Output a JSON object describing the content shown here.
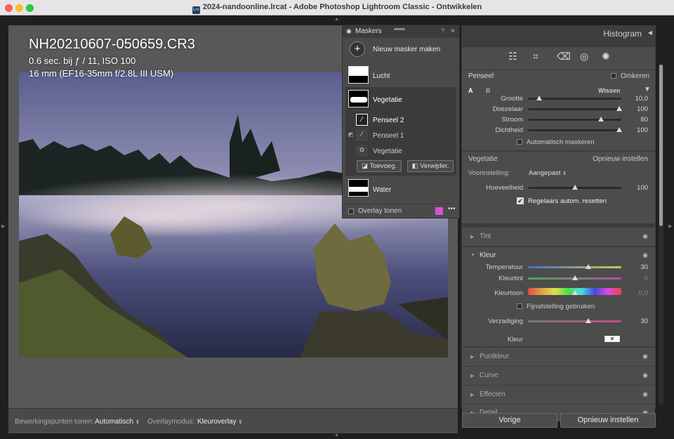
{
  "window": {
    "title": "2024-nandoonline.lrcat - Adobe Photoshop Lightroom Classic - Ontwikkelen",
    "icon_text": "Lrc"
  },
  "photo": {
    "filename": "NH20210607-050659.CR3",
    "exposure": "0.6 sec. bij ƒ / 11, ISO 100",
    "lens": "16 mm (EF16-35mm f/2.8L III USM)"
  },
  "toolbar": {
    "points_label": "Bewerkingspunten tonen:",
    "points_value": "Automatisch",
    "overlay_label": "Overlaymodus:",
    "overlay_value": "Kleuroverlay"
  },
  "masks": {
    "title": "Maskers",
    "new_mask": "Nieuw masker maken",
    "items": [
      "Lucht",
      "Vegetatie",
      "Penseel 2",
      "Penseel 1",
      "Vegetatie",
      "Water"
    ],
    "add": "Toevoeg.",
    "remove": "Verwijder.",
    "overlay": "Overlay tonen",
    "overlay_color": "#d94fd9"
  },
  "right": {
    "histogram": "Histogram",
    "brush": {
      "title": "Penseel",
      "invert": "Omkeren",
      "a": "A",
      "b": "B",
      "clear": "Wissen",
      "sliders": [
        {
          "label": "Grootte",
          "value": "10,0",
          "pos": 0.12
        },
        {
          "label": "Doezelaar",
          "value": "100",
          "pos": 0.98
        },
        {
          "label": "Stroom",
          "value": "80",
          "pos": 0.78
        },
        {
          "label": "Dichtheid",
          "value": "100",
          "pos": 0.98
        }
      ],
      "auto_mask": "Automatisch maskeren"
    },
    "veg": {
      "title": "Vegetatie",
      "reset": "Opnieuw instellen",
      "preset_label": "Voorinstelling:",
      "preset_value": "Aangepast",
      "amount_label": "Hoeveelheid",
      "amount_value": "100",
      "amount_pos": 0.5,
      "reset_sliders": "Regelaars autom. resetten"
    },
    "tint": "Tint",
    "color": {
      "title": "Kleur",
      "sliders": [
        {
          "label": "Temperatuur",
          "value": "30",
          "pos": 0.65
        },
        {
          "label": "Kleurtint",
          "value": "0",
          "pos": 0.5
        }
      ],
      "hue_label": "Kleurtoon",
      "hue_value": "0,0",
      "hue_pos": 0.5,
      "fine": "Fijnafstelling gebruiken",
      "sat_label": "Verzadiging",
      "sat_value": "30",
      "sat_pos": 0.65,
      "kleur": "Kleur"
    },
    "sections": [
      "Puntkleur",
      "Curve",
      "Effecten",
      "Detail"
    ],
    "prev": "Vorige",
    "reset_all": "Opnieuw instellen"
  }
}
